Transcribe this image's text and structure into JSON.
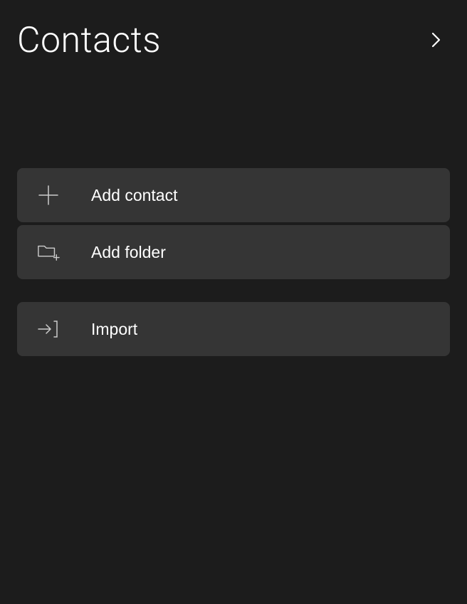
{
  "header": {
    "title": "Contacts"
  },
  "actions": {
    "add_contact_label": "Add contact",
    "add_folder_label": "Add folder",
    "import_label": "Import"
  }
}
